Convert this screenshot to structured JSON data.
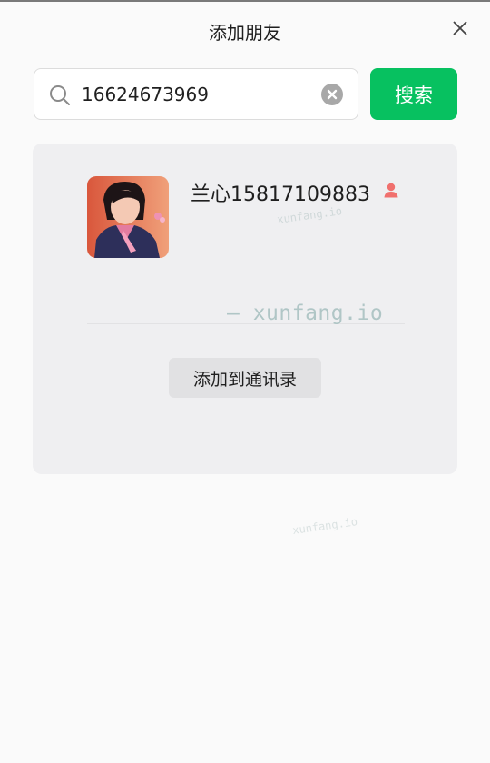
{
  "window": {
    "title": "添加朋友"
  },
  "search": {
    "query": "16624673969",
    "button_label": "搜索"
  },
  "result": {
    "name": "兰心15817109883",
    "gender_icon": "female-person-icon",
    "add_button_label": "添加到通讯录"
  },
  "watermark": {
    "text": "xunfang.io",
    "large_text": "— xunfang.io"
  },
  "colors": {
    "accent_green": "#07c160",
    "gender_icon": "#f0706e"
  }
}
